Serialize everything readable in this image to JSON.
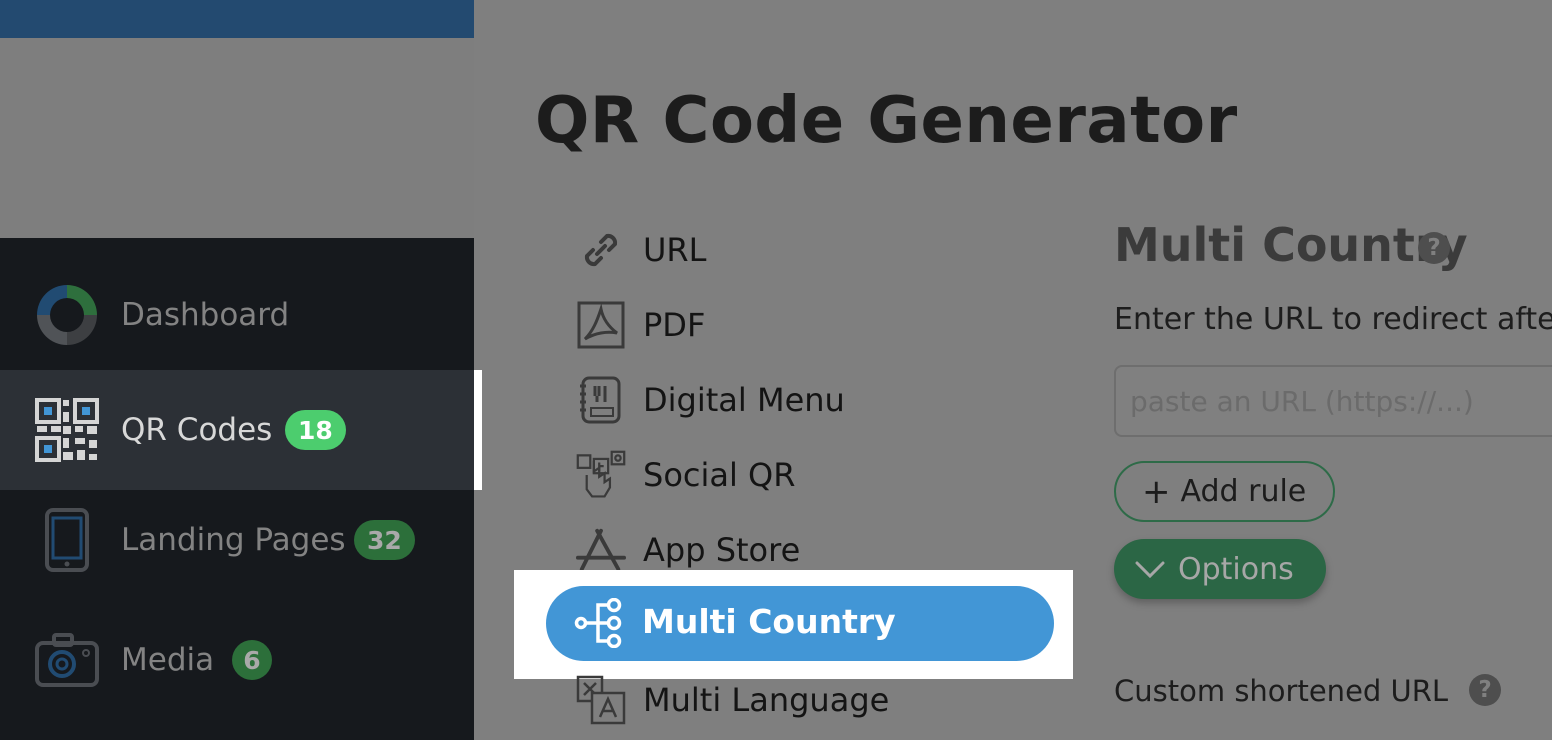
{
  "sidebar": {
    "items": [
      {
        "label": "Dashboard",
        "icon": "dashboard-donut-icon"
      },
      {
        "label": "QR Codes",
        "badge": "18",
        "icon": "qr-code-icon"
      },
      {
        "label": "Landing Pages",
        "badge": "32",
        "icon": "tablet-icon"
      },
      {
        "label": "Media",
        "badge": "6",
        "icon": "camera-icon"
      }
    ]
  },
  "main": {
    "title": "QR Code Generator",
    "types": [
      {
        "label": "URL",
        "icon": "link-icon"
      },
      {
        "label": "PDF",
        "icon": "pdf-icon"
      },
      {
        "label": "Digital Menu",
        "icon": "menu-icon"
      },
      {
        "label": "Social QR",
        "icon": "social-icon"
      },
      {
        "label": "App Store",
        "icon": "app-store-icon"
      },
      {
        "label": "Multi Country",
        "icon": "branch-icon"
      },
      {
        "label": "Multi Language",
        "icon": "translate-icon"
      }
    ],
    "selected_type": "Multi Country"
  },
  "panel": {
    "title": "Multi Country",
    "instruction": "Enter the URL to redirect after",
    "url_placeholder": "paste an URL (https://...)",
    "add_rule_label": "Add rule",
    "options_label": "Options",
    "custom_url_label": "Custom shortened URL"
  },
  "colors": {
    "selected_pill": "#4296d6",
    "badge_active": "#4ccd6e",
    "badge_dim": "#2c6f3a",
    "topbar": "#234a70",
    "options_button": "#2b6645"
  }
}
